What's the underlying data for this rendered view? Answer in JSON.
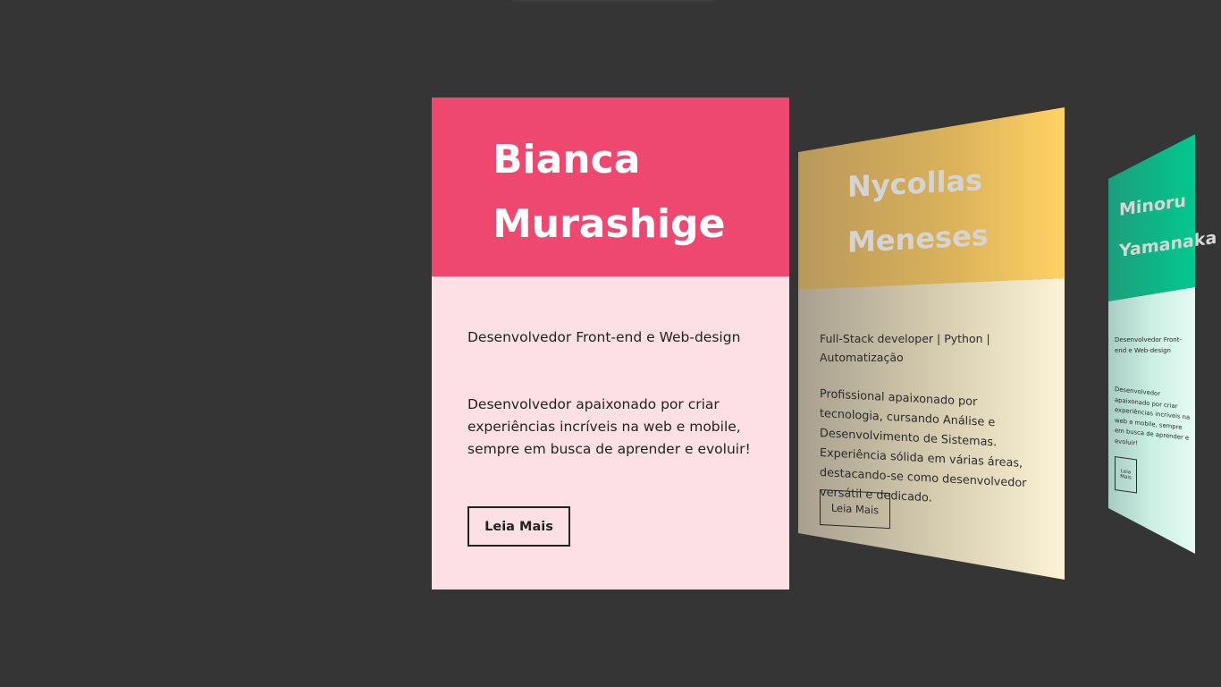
{
  "colors": {
    "background": "#353535",
    "card1_header": "#ef4870",
    "card1_body": "#fde0e6",
    "card2_header": "#ffd263",
    "card2_body": "#fdf4d8",
    "card3_header": "#02c88f",
    "card3_body": "#e4fbf3"
  },
  "cards": [
    {
      "name_line1": "Bianca",
      "name_line2": "Murashige",
      "role": "Desenvolvedor Front-end e Web-design",
      "description": "Desenvolvedor apaixonado por criar experiências incríveis na web e mobile, sempre em busca de aprender e evoluir!",
      "button_label": "Leia Mais"
    },
    {
      "name_line1": "Nycollas",
      "name_line2": "Meneses",
      "role": "Full-Stack developer | Python | Automatização",
      "description": "Profissional apaixonado por tecnologia, cursando Análise e Desenvolvimento de Sistemas. Experiência sólida em várias áreas, destacando-se como desenvolvedor versátil e dedicado.",
      "button_label": "Leia Mais"
    },
    {
      "name_line1": "Minoru",
      "name_line2": "Yamanaka",
      "role": "Desenvolvedor Front-end e Web-design",
      "description": "Desenvolvedor apaixonado por criar experiências incríveis na web e mobile, sempre em busca de aprender e evoluir!",
      "button_label": "Leia Mais"
    }
  ]
}
